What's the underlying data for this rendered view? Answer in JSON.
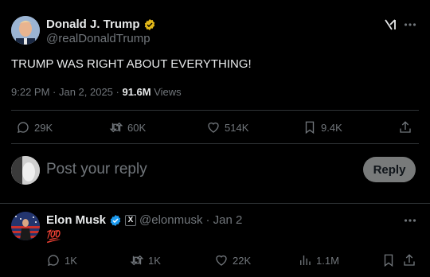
{
  "tweet": {
    "author_name": "Donald J. Trump",
    "author_handle": "@realDonaldTrump",
    "text": "TRUMP WAS RIGHT ABOUT EVERYTHING!",
    "time": "9:22 PM · Jan 2, 2025 · ",
    "views_count": "91.6M",
    "views_label": "Views",
    "stats": {
      "replies": "29K",
      "reposts": "60K",
      "likes": "514K",
      "bookmarks": "9.4K"
    }
  },
  "reply_box": {
    "placeholder": "Post your reply",
    "button_label": "Reply"
  },
  "reply": {
    "author_name": "Elon Musk",
    "affiliate_badge": "X",
    "author_handle": "@elonmusk",
    "date": "· Jan 2",
    "text": "💯",
    "stats": {
      "replies": "1K",
      "reposts": "1K",
      "likes": "22K",
      "views": "1.1M"
    }
  },
  "colors": {
    "background": "#000000",
    "verified_gold": "#e2b719",
    "verified_blue": "#1d9bf0",
    "muted": "#71767b",
    "divider": "#2f3336"
  }
}
